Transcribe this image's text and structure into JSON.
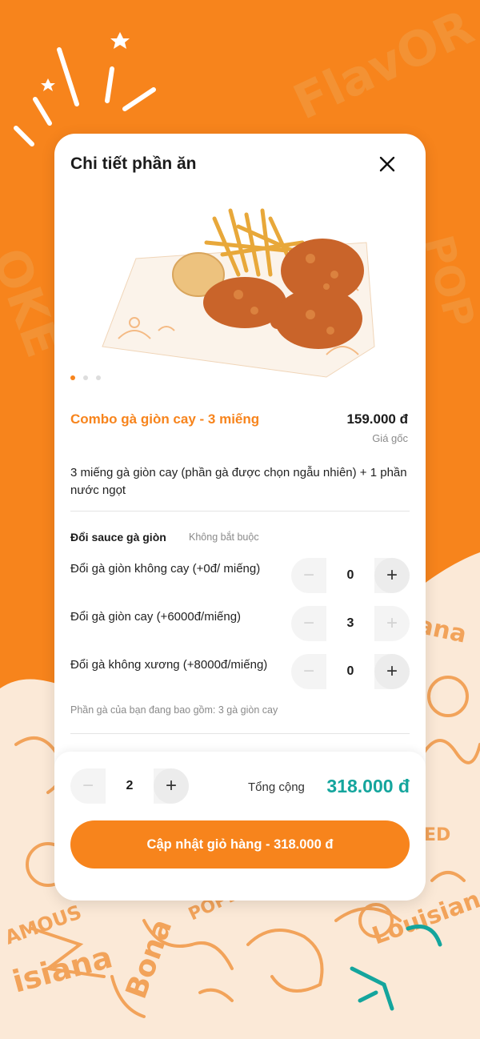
{
  "modal": {
    "title": "Chi tiết phần ăn",
    "close_icon": "close-icon",
    "carousel": {
      "count": 3,
      "active": 0
    }
  },
  "product": {
    "name": "Combo gà giòn cay - 3 miếng",
    "price": "159.000 đ",
    "price_note": "Giá gốc",
    "description": "3 miếng gà giòn cay (phần gà được chọn ngẫu nhiên) + 1 phần nước ngọt"
  },
  "sauce_section": {
    "title": "Đổi sauce gà giòn",
    "subtitle": "Không bắt buộc",
    "options": [
      {
        "label": "Đổi gà giòn không cay (+0đ/ miếng)",
        "value": "0"
      },
      {
        "label": "Đổi gà giòn cay (+6000đ/miếng)",
        "value": "3"
      },
      {
        "label": "Đổi gà không xương (+8000đ/miếng)",
        "value": "0"
      }
    ],
    "note": "Phần gà của bạn đang bao gồm: 3 gà giòn cay"
  },
  "footer": {
    "quantity": "2",
    "total_label": "Tổng cộng",
    "total_value": "318.000 đ",
    "cta_label": "Cập nhật giỏ hàng - 318.000 đ"
  },
  "stepper": {
    "minus": "−",
    "plus": "+"
  },
  "colors": {
    "accent": "#f7841c",
    "total": "#14a59d"
  }
}
